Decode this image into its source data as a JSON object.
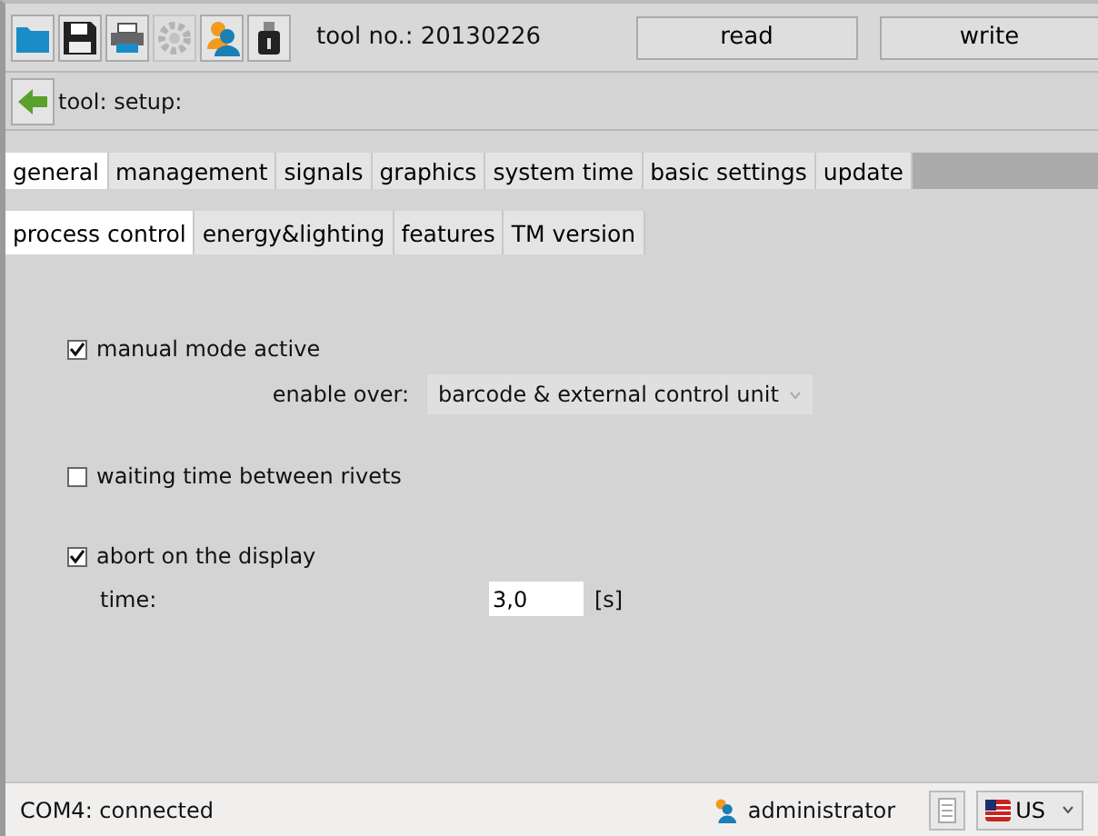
{
  "toolbar": {
    "tools": [
      {
        "kind": "folder",
        "disabled": false
      },
      {
        "kind": "save",
        "disabled": false
      },
      {
        "kind": "print",
        "disabled": false
      },
      {
        "kind": "gear",
        "disabled": true
      },
      {
        "kind": "user",
        "disabled": false
      },
      {
        "kind": "usb",
        "disabled": false
      }
    ],
    "tool_no": "tool no.: 20130226",
    "buttons": [
      "read",
      "write"
    ]
  },
  "breadcrumb": "tool: setup:",
  "tabs": [
    {
      "label": "general",
      "selected": true
    },
    {
      "label": "management",
      "selected": false
    },
    {
      "label": "signals",
      "selected": false
    },
    {
      "label": "graphics",
      "selected": false
    },
    {
      "label": "system time",
      "selected": false
    },
    {
      "label": "basic settings",
      "selected": false
    },
    {
      "label": "update",
      "selected": false
    }
  ],
  "subtabs": [
    {
      "label": "process control",
      "selected": true
    },
    {
      "label": "energy&lighting",
      "selected": false
    },
    {
      "label": "features",
      "selected": false
    },
    {
      "label": "TM version",
      "selected": false
    }
  ],
  "options": [
    {
      "label": "manual mode active",
      "checked": true,
      "field": {
        "label": "enable over:",
        "kind": "select",
        "value": "barcode & external control unit"
      }
    },
    {
      "label": "waiting time between rivets",
      "checked": false
    },
    {
      "label": "abort on the display",
      "checked": true,
      "field": {
        "label": "time:",
        "kind": "input",
        "value": "3,0",
        "unit": "[s]"
      }
    }
  ],
  "status_bar": {
    "connection": "COM4: connected",
    "user": "administrator",
    "language": "US"
  }
}
